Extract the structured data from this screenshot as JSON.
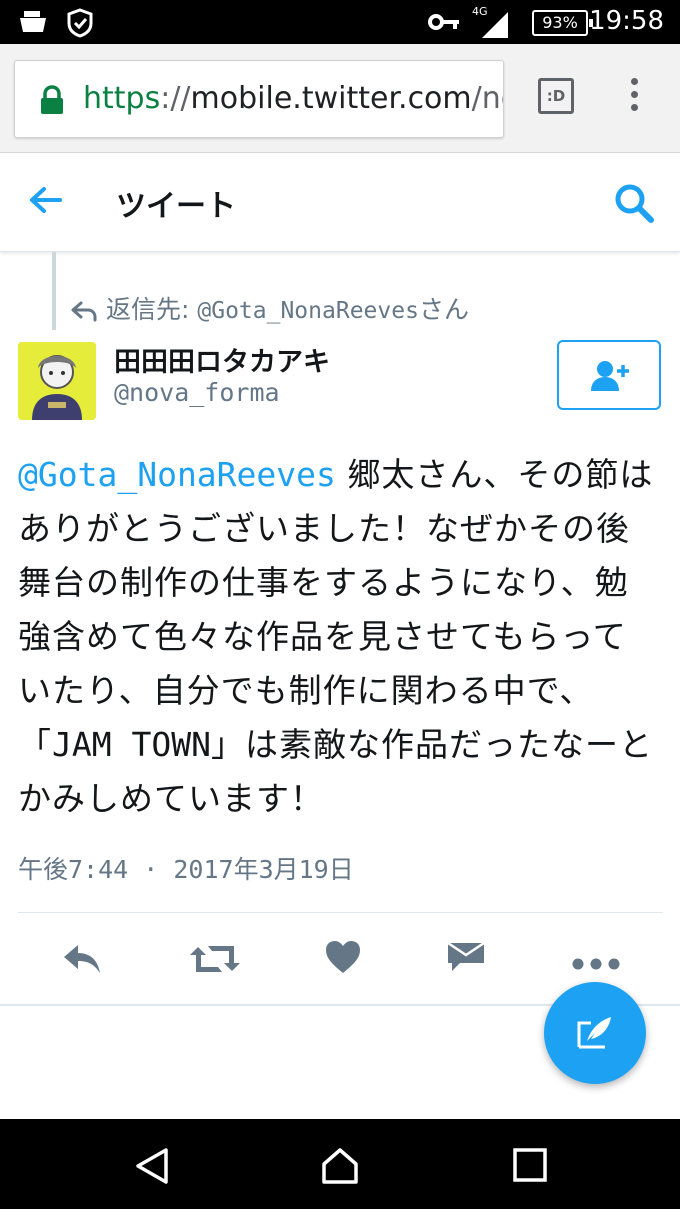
{
  "status_bar": {
    "time": "19:58",
    "battery": "93%",
    "network": "4G",
    "icons": [
      "notification-icon",
      "shield-icon",
      "key-icon",
      "signal-icon",
      "battery-icon"
    ]
  },
  "browser": {
    "url_scheme": "https",
    "url_separator": "://",
    "url_host": "mobile.twitter.com",
    "url_path": "/nov",
    "tabs_label": ":D"
  },
  "app_bar": {
    "title": "ツイート"
  },
  "reply_context": {
    "prefix": "返信先: ",
    "target": "@Gota_NonaReeves",
    "suffix": "さん"
  },
  "author": {
    "display_name": "田田田ロタカアキ",
    "handle": "@nova_forma"
  },
  "tweet": {
    "mention": "@Gota_NonaReeves",
    "line1_rest": " 郷太さん、その節は",
    "line2": "ありがとうございました！なぜかその後",
    "line3": "舞台の制作の仕事をするようになり、勉",
    "line4": "強含めて色々な作品を見させてもらって",
    "line5": "いたり、自分でも制作に関わる中で、",
    "line6_open": "「",
    "line6_title": "JAM TOWN",
    "line6_rest": "」は素敵な作品だったなーと",
    "line7": "かみしめています！",
    "timestamp": "午後7:44 · 2017年3月19日"
  },
  "colors": {
    "accent": "#1da1f2",
    "secondary_text": "#657786",
    "action_icon": "#657786",
    "url_green": "#0b8043"
  }
}
